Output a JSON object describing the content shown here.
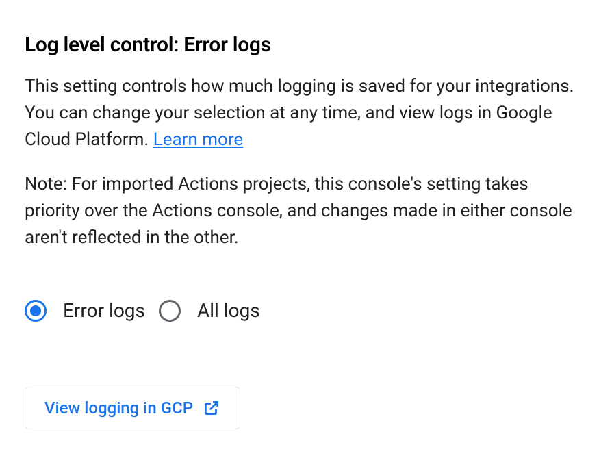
{
  "heading": "Log level control: Error logs",
  "description_part1": "This setting controls how much logging is saved for your integrations. You can change your selection at any time, and view logs in Google Cloud Platform. ",
  "learn_more_label": "Learn more",
  "note": "Note: For imported Actions projects, this console's setting takes priority over the Actions console, and changes made in either console aren't reflected in the other.",
  "radio_options": {
    "error_logs": "Error logs",
    "all_logs": "All logs"
  },
  "selected_option": "error_logs",
  "view_button_label": "View logging in GCP",
  "colors": {
    "primary": "#1a73e8",
    "text": "#202124",
    "border": "#dadce0",
    "radio_unselected": "#5f6368"
  }
}
